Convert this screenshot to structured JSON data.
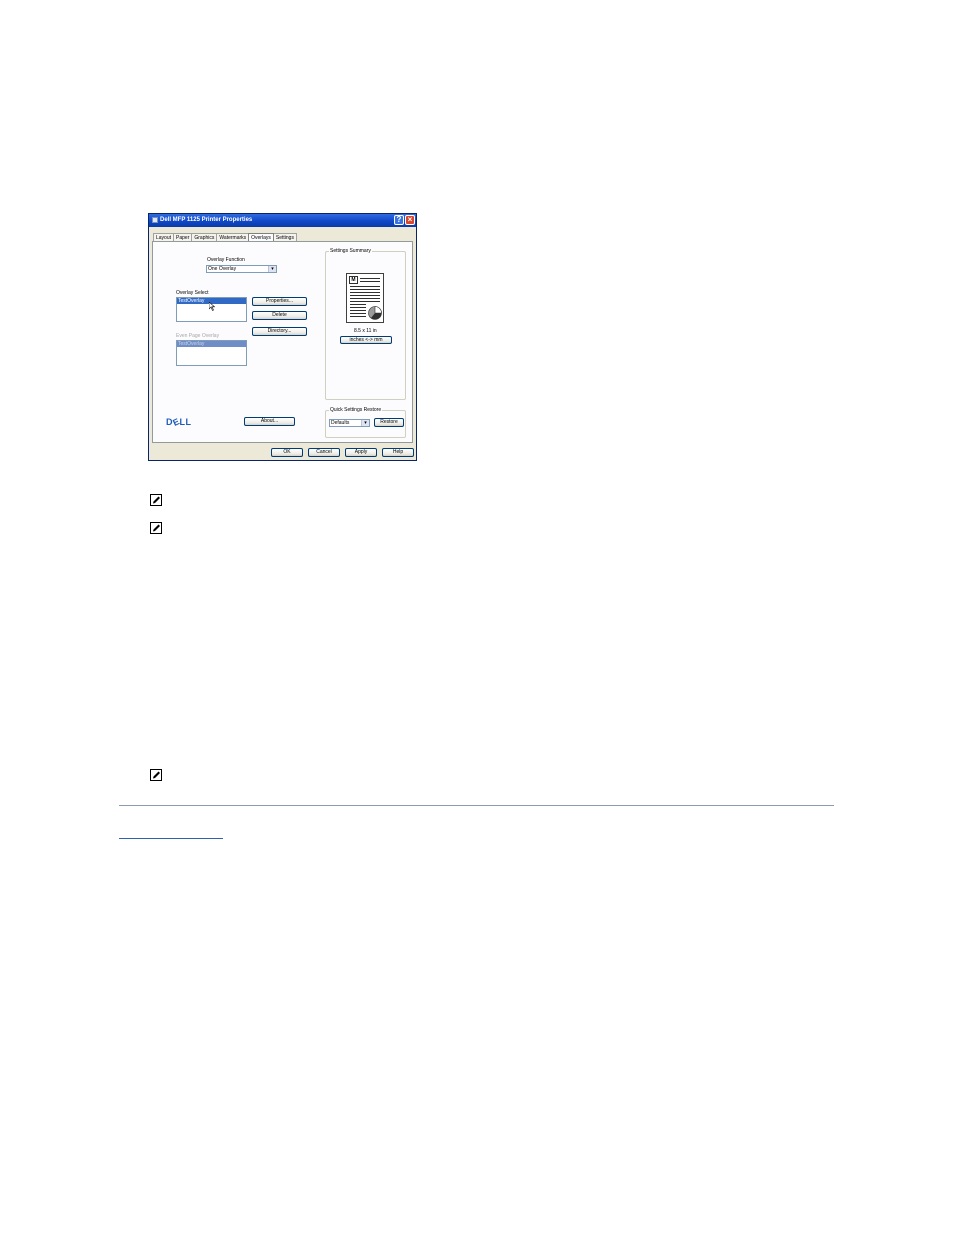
{
  "dialog": {
    "title": "Dell MFP 1125 Printer Properties",
    "tabs": [
      "Layout",
      "Paper",
      "Graphics",
      "Watermarks",
      "Overlays",
      "Settings"
    ],
    "active_tab": "Overlays",
    "overlay_function": {
      "label": "Overlay Function",
      "value": "One Overlay"
    },
    "overlay_select": {
      "label": "Overlay Select",
      "selected": "TestOverlay"
    },
    "even_page_overlay": {
      "label": "Even Page Overlay",
      "selected": "TestOverlay"
    },
    "buttons": {
      "properties": "Properties...",
      "delete": "Delete",
      "directory": "Directory...",
      "about": "About..."
    },
    "settings_summary": {
      "label": "Settings Summary",
      "page_glyph": "M",
      "paper_size": "8.5 x 11 in",
      "units_toggle": "inches <-> mm"
    },
    "quick_settings": {
      "label": "Quick Settings Restore",
      "value": "Defaults",
      "restore": "Restore"
    },
    "logo_text": "D&LL",
    "footer_buttons": {
      "ok": "OK",
      "cancel": "Cancel",
      "apply": "Apply",
      "help": "Help"
    },
    "icons": [
      "printer-icon",
      "help-icon",
      "close-icon",
      "pointer-cursor-icon",
      "dropdown-arrow-icon",
      "pie-chart-icon"
    ]
  },
  "notes": {
    "icon": "note-pencil-icon",
    "count": 3
  },
  "colors": {
    "titlebar": "#1048c8",
    "selection": "#316ac5",
    "dell_blue": "#1c5cb8",
    "dialog_bg": "#ece9d8"
  }
}
